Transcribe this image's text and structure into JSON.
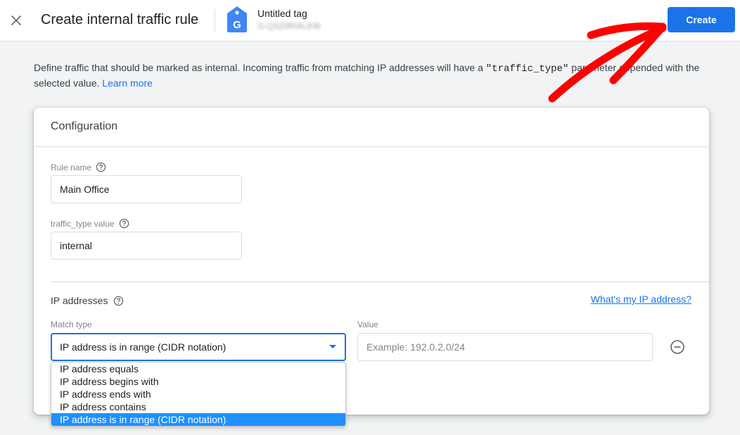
{
  "header": {
    "close_icon": "close-icon",
    "title": "Create internal traffic rule",
    "tag": {
      "icon": "google-tag-icon",
      "name": "Untitled tag",
      "id_blurred": "G-QSZ0R0KJH8"
    },
    "create_label": "Create"
  },
  "description": {
    "text_before": "Define traffic that should be marked as internal. Incoming traffic from matching IP addresses will have a ",
    "code": "\"traffic_type\"",
    "text_after": " parameter appended with the selected value. ",
    "learn_more": "Learn more"
  },
  "config": {
    "title": "Configuration",
    "rule_name": {
      "label": "Rule name",
      "value": "Main Office"
    },
    "traffic_type": {
      "label": "traffic_type value",
      "value": "internal"
    },
    "ip_section": {
      "title": "IP addresses",
      "whats_my_ip": "What's my IP address?",
      "match_type_label": "Match type",
      "match_type_selected": "IP address is in range (CIDR notation)",
      "value_label": "Value",
      "value_placeholder": "Example: 192.0.2.0/24",
      "value": ""
    }
  },
  "dropdown": {
    "options": [
      "IP address equals",
      "IP address begins with",
      "IP address ends with",
      "IP address contains",
      "IP address is in range (CIDR notation)"
    ],
    "selected_index": 4
  },
  "colors": {
    "accent": "#1a73e8",
    "dropdown_highlight": "#1e90ff",
    "annotation_arrow": "#ff0000"
  }
}
